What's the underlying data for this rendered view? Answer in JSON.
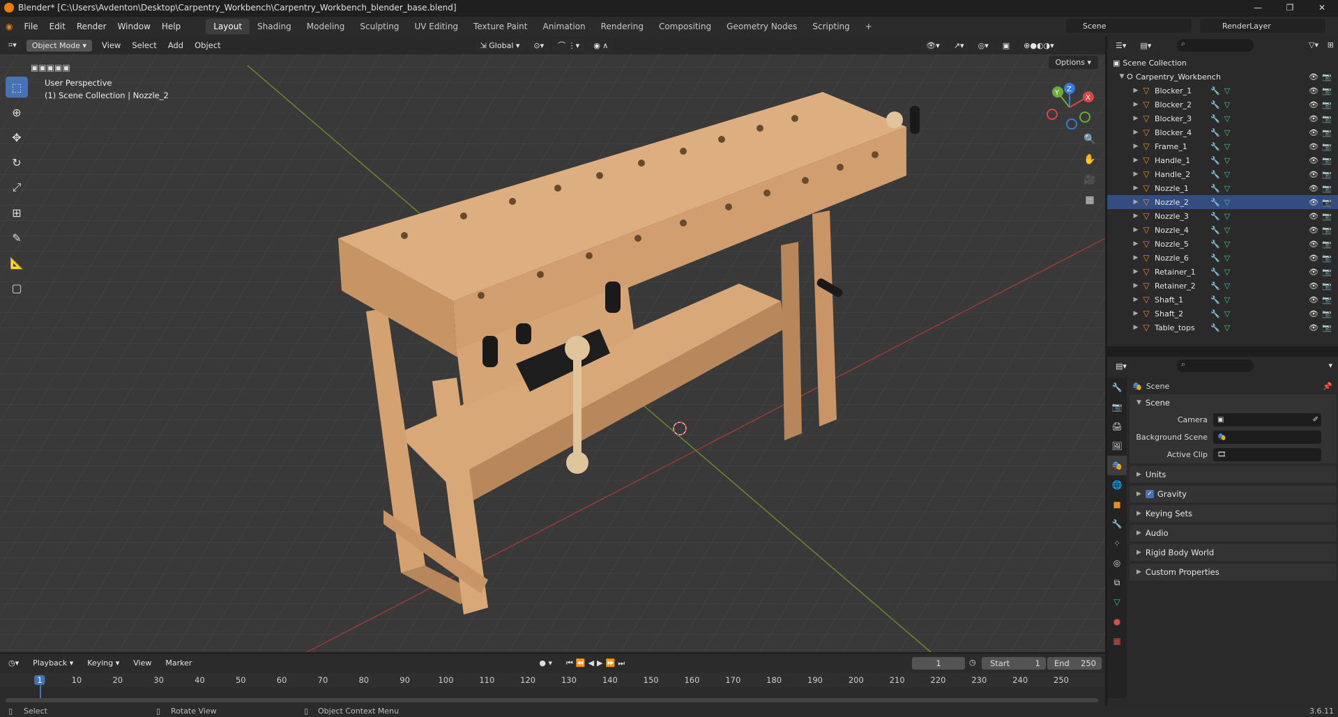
{
  "window": {
    "title": "Blender* [C:\\Users\\Avdenton\\Desktop\\Carpentry_Workbench\\Carpentry_Workbench_blender_base.blend]",
    "controls": [
      "—",
      "❐",
      "✕"
    ]
  },
  "menu": [
    "File",
    "Edit",
    "Render",
    "Window",
    "Help"
  ],
  "workspaces": [
    {
      "label": "Layout",
      "active": true
    },
    {
      "label": "Shading"
    },
    {
      "label": "Modeling"
    },
    {
      "label": "Sculpting"
    },
    {
      "label": "UV Editing"
    },
    {
      "label": "Texture Paint"
    },
    {
      "label": "Animation"
    },
    {
      "label": "Rendering"
    },
    {
      "label": "Compositing"
    },
    {
      "label": "Geometry Nodes"
    },
    {
      "label": "Scripting"
    }
  ],
  "add_workspace": "+",
  "scene_selector": "Scene",
  "render_layer": "RenderLayer",
  "viewport": {
    "mode": "Object Mode",
    "menu": [
      "View",
      "Select",
      "Add",
      "Object"
    ],
    "transform_orientation": "Global",
    "options_label": "Options",
    "info_line1": "User Perspective",
    "info_line2": "(1) Scene Collection | Nozzle_2"
  },
  "gizmo": {
    "x": "X",
    "y": "Y",
    "z": "Z"
  },
  "timeline": {
    "menu": [
      "Playback",
      "Keying",
      "View",
      "Marker"
    ],
    "current_frame": "1",
    "start_label": "Start",
    "start": "1",
    "end_label": "End",
    "end": "250",
    "ticks": [
      "1",
      "10",
      "20",
      "30",
      "40",
      "50",
      "60",
      "70",
      "80",
      "90",
      "100",
      "110",
      "120",
      "130",
      "140",
      "150",
      "160",
      "170",
      "180",
      "190",
      "200",
      "210",
      "220",
      "230",
      "240",
      "250"
    ]
  },
  "status": {
    "select": "Select",
    "rotate": "Rotate View",
    "context": "Object Context Menu",
    "version": "3.6.11"
  },
  "outliner": {
    "root": "Scene Collection",
    "collection": "Carpentry_Workbench",
    "objects": [
      "Blocker_1",
      "Blocker_2",
      "Blocker_3",
      "Blocker_4",
      "Frame_1",
      "Handle_1",
      "Handle_2",
      "Nozzle_1",
      "Nozzle_2",
      "Nozzle_3",
      "Nozzle_4",
      "Nozzle_5",
      "Nozzle_6",
      "Retainer_1",
      "Retainer_2",
      "Shaft_1",
      "Shaft_2",
      "Table_tops"
    ],
    "selected": "Nozzle_2"
  },
  "properties": {
    "context_title": "Scene",
    "scene_panel": "Scene",
    "camera_label": "Camera",
    "bg_scene_label": "Background Scene",
    "active_clip_label": "Active Clip",
    "collapsed_panels": [
      "Units",
      "Gravity",
      "Keying Sets",
      "Audio",
      "Rigid Body World",
      "Custom Properties"
    ]
  },
  "colors": {
    "accent": "#4772b3",
    "object_icon": "#e98c2a",
    "mesh_icon": "#43c88b",
    "wood": "#d9a878"
  }
}
